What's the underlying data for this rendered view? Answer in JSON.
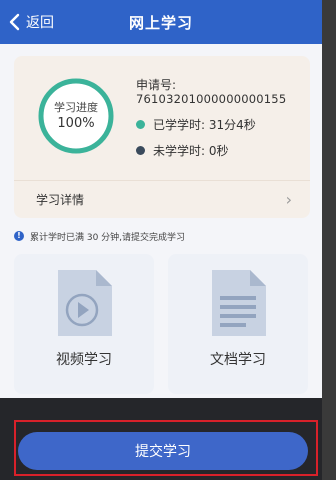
{
  "header": {
    "back_label": "返回",
    "title": "网上学习"
  },
  "progress_card": {
    "ring_label": "学习进度",
    "ring_value": "100%",
    "progress_fraction": 1.0,
    "application_label": "申请号:",
    "application_number": "76103201000000000155",
    "studied_label": "已学学时: 31分4秒",
    "unstudied_label": "未学学时: 0秒",
    "detail_label": "学习详情"
  },
  "notice": {
    "text": "累计学时已满 30 分钟,请提交完成学习"
  },
  "tiles": {
    "video_label": "视频学习",
    "document_label": "文档学习"
  },
  "submit": {
    "label": "提交学习"
  },
  "colors": {
    "header": "#2f63c8",
    "ring": "#3bb39a",
    "studied_dot": "#3bb39a",
    "unstudied_dot": "#3a4a5c",
    "submit": "#3e67c9",
    "highlight": "#d8212a"
  }
}
